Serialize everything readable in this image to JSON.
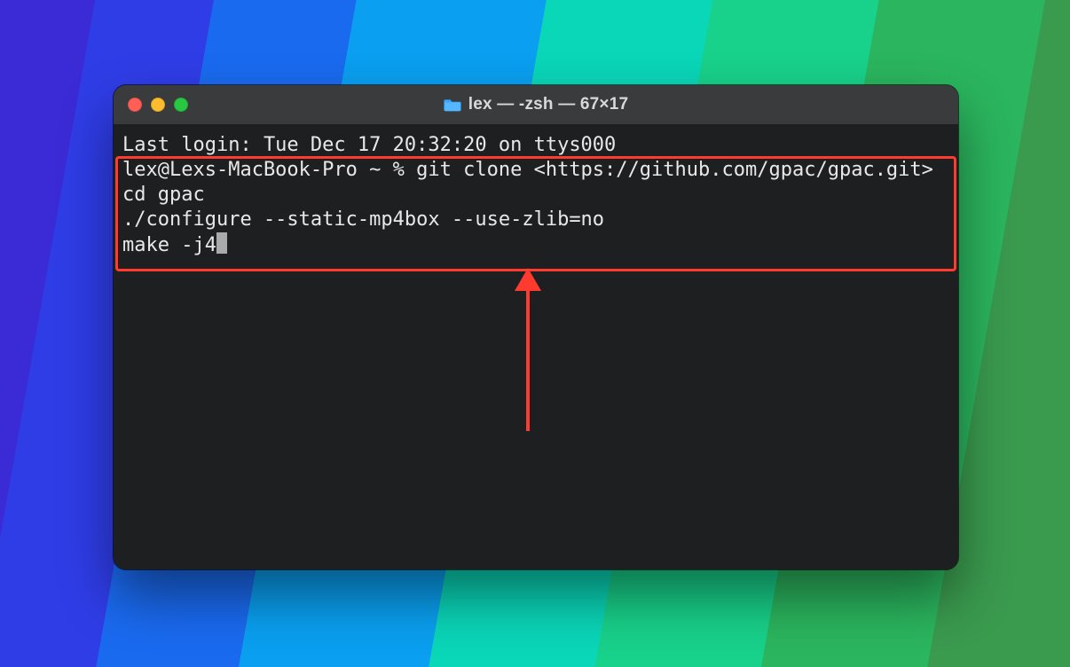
{
  "window": {
    "title": "lex — -zsh — 67×17",
    "folder_icon_color": "#3aa7ff"
  },
  "terminal": {
    "lines": {
      "l0": "Last login: Tue Dec 17 20:32:20 on ttys000",
      "l1": "lex@Lexs-MacBook-Pro ~ % git clone <https://github.com/gpac/gpac.git>",
      "l2": "cd gpac",
      "l3": "./configure --static-mp4box --use-zlib=no",
      "l4": "make -j4"
    }
  },
  "annotation": {
    "highlight_color": "#ff3b30"
  }
}
